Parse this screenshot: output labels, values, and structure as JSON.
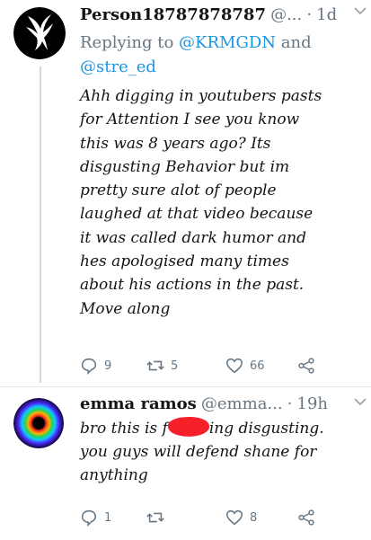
{
  "tweets": [
    {
      "display_name": "Person18787878787",
      "handle": "@...",
      "separator": "·",
      "time": "1d",
      "reply_prefix": "Replying to ",
      "reply_mention_1": "@KRMGDN",
      "reply_and": " and",
      "reply_mention_2": "@stre_ed",
      "text": "Ahh digging in youtubers pasts\nfor Attention I see you know\nthis was 8 years ago? Its\ndisgusting Behavior but im\npretty sure alot of people\nlaughed at that video because\nit was called dark humor and\nhes apologised many times\nabout his actions in the past.\nMove along",
      "replies": "9",
      "retweets": "5",
      "likes": "66"
    },
    {
      "display_name": "emma ramos",
      "handle": "@emma...",
      "separator": "·",
      "time": "19h",
      "text_part1": "bro this is f",
      "text_part2": "ing disgusting.\nyou guys will defend shane for\nanything",
      "replies": "1",
      "retweets": "",
      "likes": "8"
    }
  ],
  "icons": {
    "avatar1": "dove-silhouette-avatar",
    "avatar2": "colorful-ring-avatar",
    "reply": "reply-icon",
    "retweet": "retweet-icon",
    "like": "heart-icon",
    "share": "share-icon",
    "menu": "chevron-down-icon"
  },
  "colors": {
    "mention": "#1b95e0",
    "secondary_text": "#697580",
    "redaction": "#f5202a"
  }
}
